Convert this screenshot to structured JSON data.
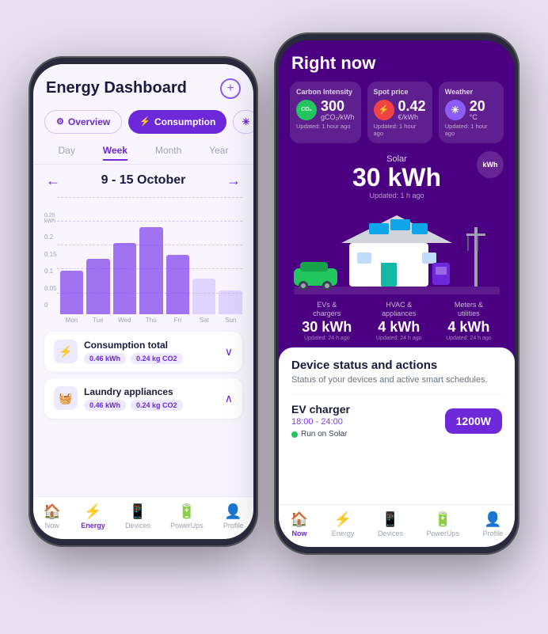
{
  "left_phone": {
    "header": {
      "title": "Energy Dashboard",
      "add_button": "+"
    },
    "tabs": [
      {
        "label": "Overview",
        "icon": "⚡",
        "active": false
      },
      {
        "label": "Consumption",
        "icon": "⚡",
        "active": true
      }
    ],
    "period_tabs": [
      "Day",
      "Week",
      "Month",
      "Year"
    ],
    "active_period": "Week",
    "date_label": "9 - 15 October",
    "chart": {
      "y_labels": [
        "0.25\nkWh",
        "0.2",
        "0.15",
        "0.1",
        "0.05",
        "0"
      ],
      "bars": [
        {
          "day": "Mon",
          "height": 55,
          "light": false
        },
        {
          "day": "Tue",
          "height": 70,
          "light": false
        },
        {
          "day": "Wed",
          "height": 90,
          "light": false
        },
        {
          "day": "Thu",
          "height": 110,
          "light": false
        },
        {
          "day": "Fri",
          "height": 75,
          "light": false
        },
        {
          "day": "Sat",
          "height": 45,
          "light": true
        },
        {
          "day": "Sun",
          "height": 30,
          "light": true
        }
      ]
    },
    "stats": [
      {
        "icon": "⚡",
        "title": "Consumption total",
        "badges": [
          "0.46 kWh",
          "0.24 kg CO2"
        ],
        "expanded": false
      },
      {
        "icon": "🧺",
        "title": "Laundry appliances",
        "badges": [
          "0.46 kWh",
          "0.24 kg CO2"
        ],
        "expanded": true
      }
    ],
    "bottom_nav": [
      {
        "label": "Now",
        "icon": "🏠",
        "active": false
      },
      {
        "label": "Energy",
        "icon": "⚡",
        "active": true
      },
      {
        "label": "Devices",
        "icon": "📱",
        "active": false
      },
      {
        "label": "PowerUps",
        "icon": "🔋",
        "active": false
      },
      {
        "label": "Profile",
        "icon": "👤",
        "active": false
      }
    ]
  },
  "right_phone": {
    "header": {
      "title": "Right now"
    },
    "metrics": [
      {
        "title": "Carbon Intensity",
        "circle_color": "green",
        "circle_text": "CO₂",
        "value": "300",
        "unit": "gCO₂/kWh",
        "updated": "Updated: 1 hour ago"
      },
      {
        "title": "Spot price",
        "circle_color": "red",
        "circle_text": "⚡",
        "value": "0.42",
        "unit": "€/kWh",
        "updated": "Updated: 1 hour ago"
      },
      {
        "title": "Weather",
        "circle_color": "purple",
        "circle_text": "☀",
        "value": "20",
        "unit": "°C",
        "updated": "Updated: 1 hour ago"
      }
    ],
    "solar": {
      "label": "Solar",
      "value": "30 kWh",
      "updated": "Updated: 1 h ago",
      "kwh_badge": "kWh"
    },
    "energy_breakdown": [
      {
        "label": "EVs &\nchargers",
        "value": "30 kWh",
        "updated": "Updated: 24 h ago"
      },
      {
        "label": "HVAC &\nappliances",
        "value": "4 kWh",
        "updated": "Updated: 24 h ago"
      },
      {
        "label": "Meters &\nutilities",
        "value": "4 kWh",
        "updated": "Updated: 24 h ago"
      }
    ],
    "device_section": {
      "title": "Device status and actions",
      "description": "Status of your devices and active smart schedules.",
      "devices": [
        {
          "name": "EV charger",
          "time": "18:00 - 24:00",
          "status": "Run on Solar",
          "power": "1200W"
        }
      ]
    },
    "bottom_nav": [
      {
        "label": "Now",
        "icon": "🏠",
        "active": true
      },
      {
        "label": "Energy",
        "icon": "⚡",
        "active": false
      },
      {
        "label": "Devices",
        "icon": "📱",
        "active": false
      },
      {
        "label": "PowerUps",
        "icon": "🔋",
        "active": false
      },
      {
        "label": "Profile",
        "icon": "👤",
        "active": false
      }
    ]
  }
}
